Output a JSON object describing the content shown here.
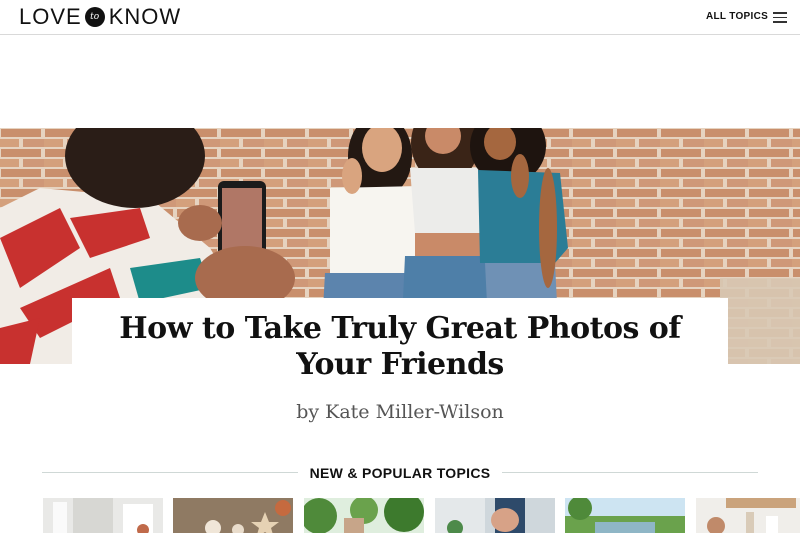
{
  "header": {
    "logo_left": "LOVE",
    "logo_mid": "to",
    "logo_right": "KNOW",
    "all_topics_label": "ALL TOPICS",
    "menu_icon": "hamburger-menu-icon"
  },
  "article": {
    "title_line1": "How to Take Truly Great Photos of",
    "title_line2": "Your Friends",
    "byline": "by Kate Miller-Wilson"
  },
  "section": {
    "title": "NEW & POPULAR TOPICS"
  },
  "colors": {
    "brick": "#c98f6c",
    "mortar": "#e6d3c0",
    "divider": "#cfd8d6"
  }
}
